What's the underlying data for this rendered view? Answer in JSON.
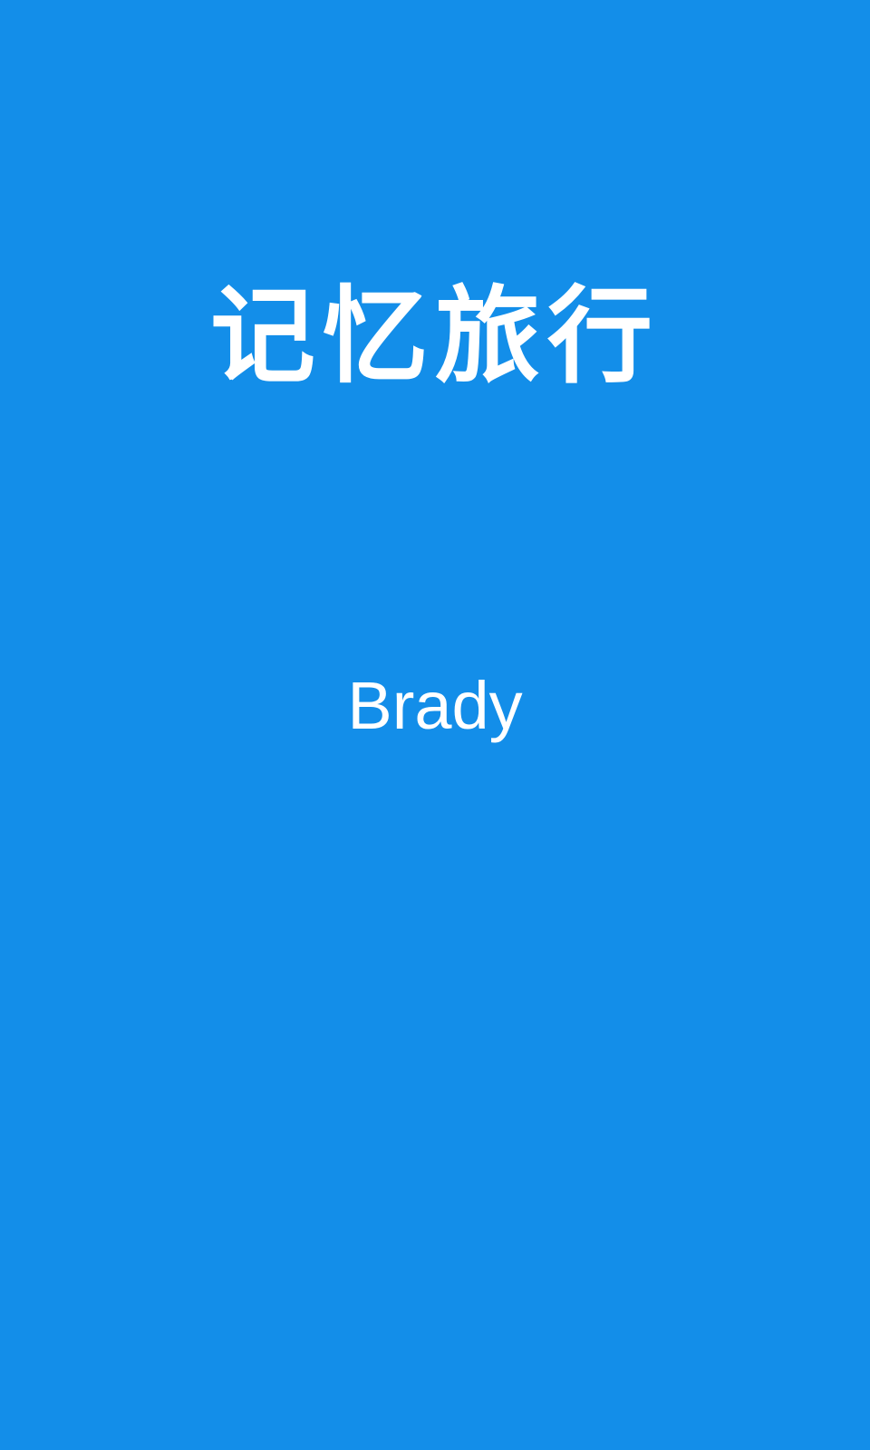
{
  "cover": {
    "title": "记忆旅行",
    "author": "Brady",
    "background_color": "#138ee9",
    "text_color": "#ffffff"
  }
}
